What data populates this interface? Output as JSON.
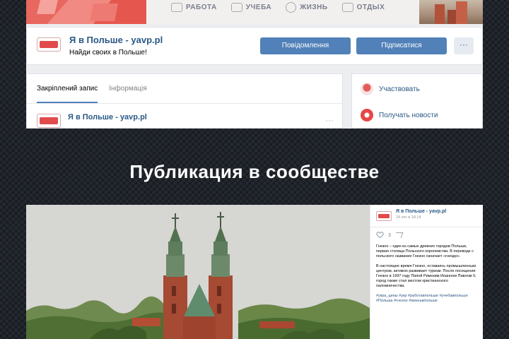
{
  "cover": {
    "nav": [
      {
        "label": "РАБОТА",
        "icon": "briefcase-icon"
      },
      {
        "label": "УЧЕБА",
        "icon": "book-icon"
      },
      {
        "label": "ЖИЗНЬ",
        "icon": "life-icon"
      },
      {
        "label": "ОТДЫХ",
        "icon": "car-icon"
      }
    ],
    "accent": "#e24b4b"
  },
  "group": {
    "name": "Я в Польше - yavp.pl",
    "status": "Найди своих в Польше!",
    "message_button": "Повідомлення",
    "subscribe_button": "Підписатися",
    "more_button": "···"
  },
  "wall": {
    "tabs": [
      "Закріплений запис",
      "Інформація"
    ],
    "post_author": "Я в Польше - yavp.pl",
    "post_menu": "···"
  },
  "sidebar": {
    "items": [
      {
        "label": "Участвовать",
        "icon": "avatar-icon"
      },
      {
        "label": "Получать новости",
        "icon": "notification-icon"
      }
    ]
  },
  "heading": "Публикация в сообществе",
  "post": {
    "author": "Я в Польше - yavp.pl",
    "date": "24 окт в 18:14",
    "likes": "3",
    "paragraphs": [
      "Гнезно – один из самых древних городов Польши, первая столица Польского королевства. В переводе с польского название Гнезно означает «гнездо».",
      "В настоящее время Гнезно, оставаясь промышленным центром, активно развивает туризм. После посещения Гнезно в 1997 году Папой Римским Иоанном Павлом II, город также стал местом христианского паломничества."
    ],
    "tags": "#укра_цины #укр #работавпольше #учебавпольше #Польша #гнезно #жизньвпольше"
  }
}
